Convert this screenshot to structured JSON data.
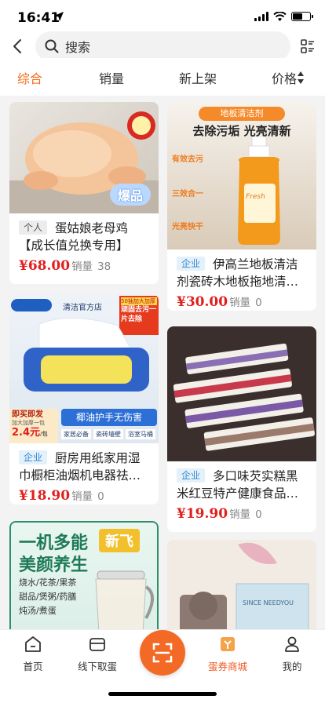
{
  "status": {
    "time": "16:41"
  },
  "search": {
    "placeholder": "搜索"
  },
  "filters": [
    {
      "label": "综合",
      "active": true
    },
    {
      "label": "销量",
      "active": false
    },
    {
      "label": "新上架",
      "active": false
    },
    {
      "label": "价格",
      "active": false
    }
  ],
  "products": [
    {
      "tag": "个人",
      "title": "蛋姑娘老母鸡【成长值兑换专用】",
      "price": "¥68.00",
      "sales_label": "销量",
      "sales": "38",
      "image_text": {
        "badge": "爆品"
      }
    },
    {
      "tag": "企业",
      "title": "伊高兰地板清洁剂瓷砖木地板拖地清洁液",
      "price": "¥30.00",
      "sales_label": "销量",
      "sales": "0",
      "image_text": {
        "banner": "地板清洁剂",
        "headline": "去除污垢 光亮清新",
        "point1": "有效去污",
        "point2": "三效合一",
        "point3": "光亮快干",
        "bottle": "Fresh"
      }
    },
    {
      "tag": "企业",
      "title": "厨房用纸家用湿巾橱柜油烟机电器祛油湿巾",
      "price": "¥18.90",
      "sales_label": "销量",
      "sales": "0",
      "image_text": {
        "store": "清洁官方店",
        "corner_top": "50抽加大加厚",
        "corner_main": "顽固去污一片去除",
        "promo": "即买即发",
        "promo_sub": "加大加厚一包",
        "promo_price": "2.4元",
        "promo_unit": "/包",
        "slogan": "椰油护手无伤害",
        "use1": "家居必备",
        "use2": "瓷砖墙壁",
        "use3": "浴室马桶",
        "pack": "50"
      }
    },
    {
      "tag": "企业",
      "title": "多口味芡实糕黑米红豆特产健康食品零食",
      "price": "¥19.90",
      "sales_label": "销量",
      "sales": "0",
      "image_text": {}
    },
    {
      "tag": "",
      "title": "",
      "price": "",
      "sales_label": "",
      "sales": "",
      "image_text": {
        "headline1": "一机多能",
        "headline2": "美颜养生",
        "brand": "新飞",
        "line1": "烧水/花茶/果茶",
        "line2": "甜品/煲粥/药膳",
        "line3": "炖汤/煮蛋"
      }
    },
    {
      "tag": "",
      "title": "",
      "price": "",
      "sales_label": "",
      "sales": "",
      "image_text": {
        "box": "SINCE NEEDYOU"
      }
    }
  ],
  "tabbar": [
    {
      "label": "首页",
      "active": false
    },
    {
      "label": "线下取蛋",
      "active": false
    },
    {
      "label": "",
      "active": false
    },
    {
      "label": "蛋券商城",
      "active": true
    },
    {
      "label": "我的",
      "active": false
    }
  ],
  "colors": {
    "accent": "#f56b1a",
    "price": "#e0201e",
    "company_tag": "#2f86d1"
  }
}
